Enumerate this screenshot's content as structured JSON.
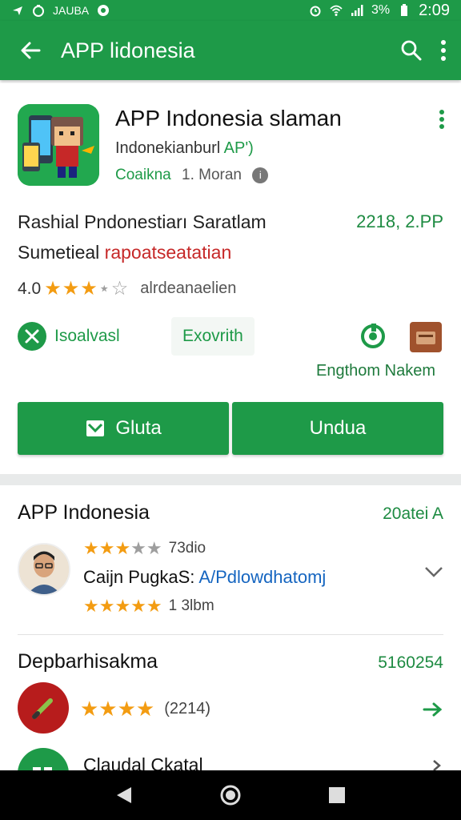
{
  "colors": {
    "brand": "#1e9a48",
    "star": "#f39c12",
    "link": "#1565c0",
    "warning": "#c62828"
  },
  "status_bar": {
    "left_text": "JAUBA",
    "battery": "3%",
    "time": "2:09"
  },
  "app_bar": {
    "title": "APP lidonesia"
  },
  "app": {
    "name": "APP Indonesia slaman",
    "subtitle_prefix": "Indonekianburl",
    "subtitle_accent": "AP')",
    "developer": "Coaikna",
    "meta": "1. Moran",
    "info_icon": "i"
  },
  "promo": {
    "line1": "Rashial Pndonestiarı Saratlam",
    "price": "2218, 2.PP",
    "line2_prefix": "Sumetieal",
    "line2_red": "rapoatseatatian"
  },
  "rating": {
    "value": "4.0",
    "stars_filled": "★★★",
    "stars_empty": "⋆☆",
    "meta": "alrdeanaelien"
  },
  "chips": {
    "chip1": "Isoalvasl",
    "chip2": "Exovrith",
    "caption": "Engthom Nakem"
  },
  "buttons": {
    "primary": "Gluta",
    "secondary": "Undua"
  },
  "review_section": {
    "title": "APP Indonesia",
    "right": "20atei A",
    "stars_top_filled": "★★★",
    "stars_top_empty": "★★",
    "stars_top_value": "73dio",
    "text_prefix": "Caijn PugkaS:",
    "text_link": "A/Pdlowdhatomj",
    "stars_bottom": "★★★★★",
    "stars_bottom_value": "1 3lbm"
  },
  "section2": {
    "title": "Depbarhisakma",
    "right": "5160254",
    "stars": "★★★★",
    "count": "(2214)"
  },
  "section3": {
    "title": "Claudal Ckatal"
  }
}
